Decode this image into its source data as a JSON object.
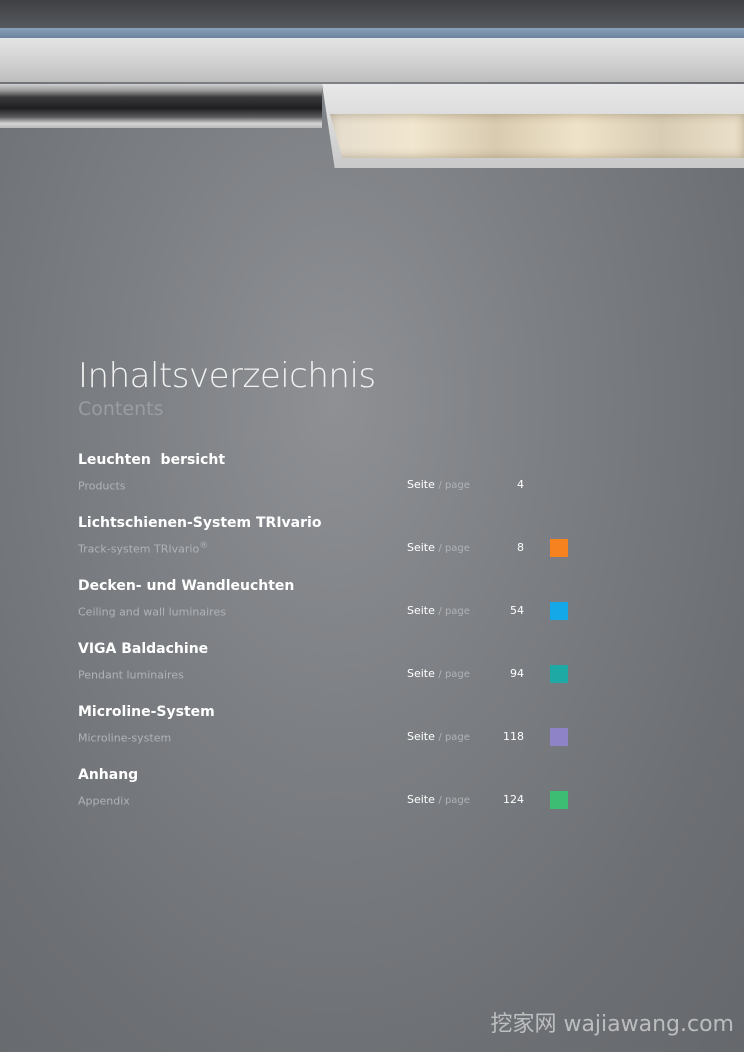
{
  "document": {
    "title": "Inhaltsverzeichnis",
    "subtitle": "Contents"
  },
  "toc": {
    "seite_label": "Seite",
    "page_label": "/ page",
    "entries": [
      {
        "heading": "Leuchten  bersicht",
        "sub": "Products",
        "sub_sup": "",
        "page": "4",
        "color": ""
      },
      {
        "heading": "Lichtschienen-System TRIvario",
        "sub": "Track-system  TRIvario",
        "sub_sup": "®",
        "page": "8",
        "color": "#f5821f"
      },
      {
        "heading": "Decken- und Wandleuchten",
        "sub": "Ceiling and wall luminaires",
        "sub_sup": "",
        "page": "54",
        "color": "#14a8e8"
      },
      {
        "heading": "VIGA Baldachine",
        "sub": "Pendant luminaires",
        "sub_sup": "",
        "page": "94",
        "color": "#1fa9a4"
      },
      {
        "heading": "Microline-System",
        "sub": "Microline-system",
        "sub_sup": "",
        "page": "118",
        "color": "#8e83c6"
      },
      {
        "heading": "Anhang",
        "sub": "Appendix",
        "sub_sup": "",
        "page": "124",
        "color": "#3dbd74"
      }
    ]
  },
  "watermark": "挖家网 wajiawang.com"
}
